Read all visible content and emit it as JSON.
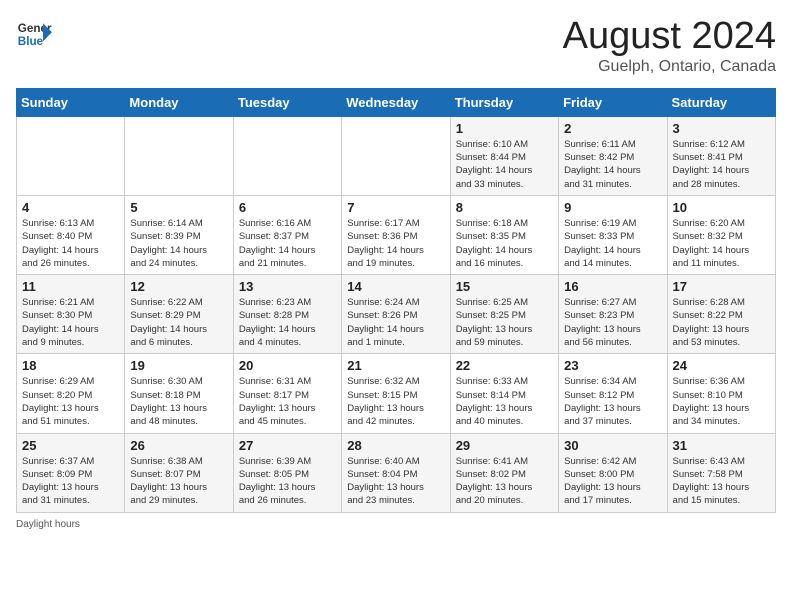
{
  "logo": {
    "line1": "General",
    "line2": "Blue"
  },
  "title": "August 2024",
  "location": "Guelph, Ontario, Canada",
  "weekdays": [
    "Sunday",
    "Monday",
    "Tuesday",
    "Wednesday",
    "Thursday",
    "Friday",
    "Saturday"
  ],
  "footer_label": "Daylight hours",
  "weeks": [
    [
      {
        "day": "",
        "info": ""
      },
      {
        "day": "",
        "info": ""
      },
      {
        "day": "",
        "info": ""
      },
      {
        "day": "",
        "info": ""
      },
      {
        "day": "1",
        "info": "Sunrise: 6:10 AM\nSunset: 8:44 PM\nDaylight: 14 hours\nand 33 minutes."
      },
      {
        "day": "2",
        "info": "Sunrise: 6:11 AM\nSunset: 8:42 PM\nDaylight: 14 hours\nand 31 minutes."
      },
      {
        "day": "3",
        "info": "Sunrise: 6:12 AM\nSunset: 8:41 PM\nDaylight: 14 hours\nand 28 minutes."
      }
    ],
    [
      {
        "day": "4",
        "info": "Sunrise: 6:13 AM\nSunset: 8:40 PM\nDaylight: 14 hours\nand 26 minutes."
      },
      {
        "day": "5",
        "info": "Sunrise: 6:14 AM\nSunset: 8:39 PM\nDaylight: 14 hours\nand 24 minutes."
      },
      {
        "day": "6",
        "info": "Sunrise: 6:16 AM\nSunset: 8:37 PM\nDaylight: 14 hours\nand 21 minutes."
      },
      {
        "day": "7",
        "info": "Sunrise: 6:17 AM\nSunset: 8:36 PM\nDaylight: 14 hours\nand 19 minutes."
      },
      {
        "day": "8",
        "info": "Sunrise: 6:18 AM\nSunset: 8:35 PM\nDaylight: 14 hours\nand 16 minutes."
      },
      {
        "day": "9",
        "info": "Sunrise: 6:19 AM\nSunset: 8:33 PM\nDaylight: 14 hours\nand 14 minutes."
      },
      {
        "day": "10",
        "info": "Sunrise: 6:20 AM\nSunset: 8:32 PM\nDaylight: 14 hours\nand 11 minutes."
      }
    ],
    [
      {
        "day": "11",
        "info": "Sunrise: 6:21 AM\nSunset: 8:30 PM\nDaylight: 14 hours\nand 9 minutes."
      },
      {
        "day": "12",
        "info": "Sunrise: 6:22 AM\nSunset: 8:29 PM\nDaylight: 14 hours\nand 6 minutes."
      },
      {
        "day": "13",
        "info": "Sunrise: 6:23 AM\nSunset: 8:28 PM\nDaylight: 14 hours\nand 4 minutes."
      },
      {
        "day": "14",
        "info": "Sunrise: 6:24 AM\nSunset: 8:26 PM\nDaylight: 14 hours\nand 1 minute."
      },
      {
        "day": "15",
        "info": "Sunrise: 6:25 AM\nSunset: 8:25 PM\nDaylight: 13 hours\nand 59 minutes."
      },
      {
        "day": "16",
        "info": "Sunrise: 6:27 AM\nSunset: 8:23 PM\nDaylight: 13 hours\nand 56 minutes."
      },
      {
        "day": "17",
        "info": "Sunrise: 6:28 AM\nSunset: 8:22 PM\nDaylight: 13 hours\nand 53 minutes."
      }
    ],
    [
      {
        "day": "18",
        "info": "Sunrise: 6:29 AM\nSunset: 8:20 PM\nDaylight: 13 hours\nand 51 minutes."
      },
      {
        "day": "19",
        "info": "Sunrise: 6:30 AM\nSunset: 8:18 PM\nDaylight: 13 hours\nand 48 minutes."
      },
      {
        "day": "20",
        "info": "Sunrise: 6:31 AM\nSunset: 8:17 PM\nDaylight: 13 hours\nand 45 minutes."
      },
      {
        "day": "21",
        "info": "Sunrise: 6:32 AM\nSunset: 8:15 PM\nDaylight: 13 hours\nand 42 minutes."
      },
      {
        "day": "22",
        "info": "Sunrise: 6:33 AM\nSunset: 8:14 PM\nDaylight: 13 hours\nand 40 minutes."
      },
      {
        "day": "23",
        "info": "Sunrise: 6:34 AM\nSunset: 8:12 PM\nDaylight: 13 hours\nand 37 minutes."
      },
      {
        "day": "24",
        "info": "Sunrise: 6:36 AM\nSunset: 8:10 PM\nDaylight: 13 hours\nand 34 minutes."
      }
    ],
    [
      {
        "day": "25",
        "info": "Sunrise: 6:37 AM\nSunset: 8:09 PM\nDaylight: 13 hours\nand 31 minutes."
      },
      {
        "day": "26",
        "info": "Sunrise: 6:38 AM\nSunset: 8:07 PM\nDaylight: 13 hours\nand 29 minutes."
      },
      {
        "day": "27",
        "info": "Sunrise: 6:39 AM\nSunset: 8:05 PM\nDaylight: 13 hours\nand 26 minutes."
      },
      {
        "day": "28",
        "info": "Sunrise: 6:40 AM\nSunset: 8:04 PM\nDaylight: 13 hours\nand 23 minutes."
      },
      {
        "day": "29",
        "info": "Sunrise: 6:41 AM\nSunset: 8:02 PM\nDaylight: 13 hours\nand 20 minutes."
      },
      {
        "day": "30",
        "info": "Sunrise: 6:42 AM\nSunset: 8:00 PM\nDaylight: 13 hours\nand 17 minutes."
      },
      {
        "day": "31",
        "info": "Sunrise: 6:43 AM\nSunset: 7:58 PM\nDaylight: 13 hours\nand 15 minutes."
      }
    ]
  ]
}
